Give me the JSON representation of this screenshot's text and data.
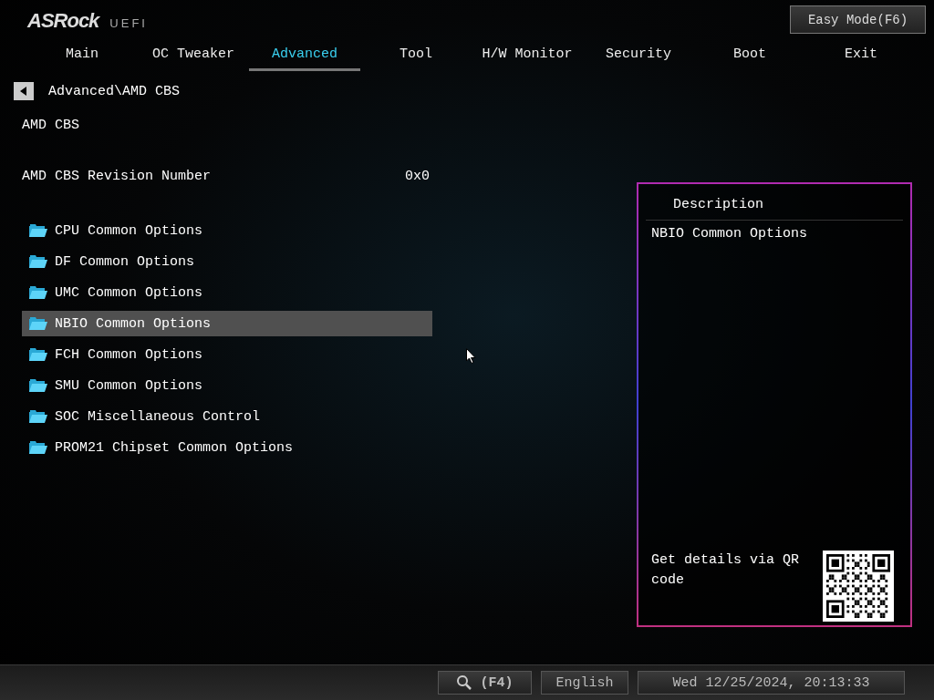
{
  "logo": {
    "brand": "ASRock",
    "product": "UEFI"
  },
  "mode_button": "Easy Mode(F6)",
  "tabs": [
    {
      "label": "Main",
      "selected": false
    },
    {
      "label": "OC Tweaker",
      "selected": false
    },
    {
      "label": "Advanced",
      "selected": true
    },
    {
      "label": "Tool",
      "selected": false
    },
    {
      "label": "H/W Monitor",
      "selected": false
    },
    {
      "label": "Security",
      "selected": false
    },
    {
      "label": "Boot",
      "selected": false
    },
    {
      "label": "Exit",
      "selected": false
    }
  ],
  "breadcrumb": "Advanced\\AMD CBS",
  "section_title": "AMD CBS",
  "info": {
    "label": "AMD CBS Revision Number",
    "value": "0x0"
  },
  "items": [
    {
      "label": "CPU Common Options",
      "selected": false
    },
    {
      "label": "DF Common Options",
      "selected": false
    },
    {
      "label": "UMC Common Options",
      "selected": false
    },
    {
      "label": "NBIO Common Options",
      "selected": true
    },
    {
      "label": "FCH Common Options",
      "selected": false
    },
    {
      "label": "SMU Common Options",
      "selected": false
    },
    {
      "label": "SOC Miscellaneous Control",
      "selected": false
    },
    {
      "label": "PROM21 Chipset Common Options",
      "selected": false
    }
  ],
  "description": {
    "title": "Description",
    "text": "NBIO Common Options",
    "qr_hint": "Get details via QR code"
  },
  "status_bar": {
    "search_key": "(F4)",
    "language": "English",
    "datetime": "Wed 12/25/2024, 20:13:33"
  }
}
